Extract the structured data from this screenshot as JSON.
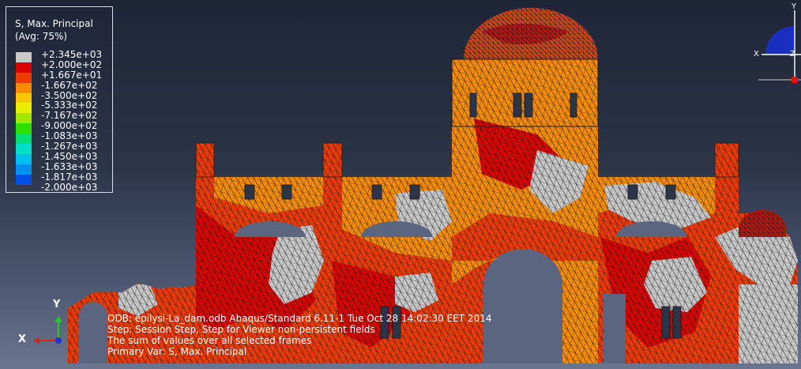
{
  "legend": {
    "title": "S, Max. Principal",
    "avg": "(Avg: 75%)",
    "entries": [
      {
        "label": "+2.345e+03",
        "color": "#c8c8c8"
      },
      {
        "label": "+2.000e+02",
        "color": "#d90000"
      },
      {
        "label": "+1.667e+01",
        "color": "#ef3a00"
      },
      {
        "label": "-1.667e+02",
        "color": "#fa8c00"
      },
      {
        "label": "-3.500e+02",
        "color": "#f8c800"
      },
      {
        "label": "-5.333e+02",
        "color": "#e6f000"
      },
      {
        "label": "-7.167e+02",
        "color": "#a0ea00"
      },
      {
        "label": "-9.000e+02",
        "color": "#2ee000"
      },
      {
        "label": "-1.083e+03",
        "color": "#00e070"
      },
      {
        "label": "-1.267e+03",
        "color": "#00e0c8"
      },
      {
        "label": "-1.450e+03",
        "color": "#00c0f0"
      },
      {
        "label": "-1.633e+03",
        "color": "#0090f0"
      },
      {
        "label": "-1.817e+03",
        "color": "#0050e8"
      },
      {
        "label": "-2.000e+03",
        "color": "#1010c8"
      }
    ]
  },
  "status": {
    "odb_line": "ODB: epilysi-La_dam.odb    Abaqus/Standard 6.11-1    Tue Oct 28 14:02:30 EET 2014",
    "step_line": "Step: Session Step, Step for Viewer non-persistent fields",
    "frames_line": "The sum of values over all selected frames",
    "var_line": "Primary Var: S, Max. Principal"
  },
  "triad_bottom_left": {
    "y_label": "Y",
    "x_label": "X"
  },
  "triad_top_right": {
    "y_label": "Y",
    "x_label": "X",
    "z_label": "Z"
  },
  "colors": {
    "mesh_line": "#1a1a1a",
    "compress": "#ef3a00",
    "peak": "#c8c8c8",
    "tension": "#d90000",
    "orange": "#fa8c00"
  }
}
